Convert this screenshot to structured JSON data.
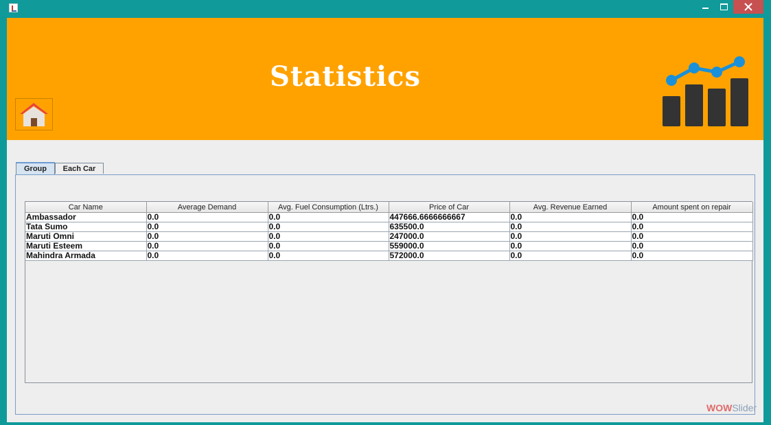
{
  "window": {
    "icon": "java-coffee-icon"
  },
  "header": {
    "title": "Statistics",
    "home_icon": "house-icon",
    "stats_icon": "bar-line-chart-icon"
  },
  "tabs": [
    {
      "label": "Group",
      "selected": true
    },
    {
      "label": "Each Car",
      "selected": false
    }
  ],
  "table": {
    "columns": [
      "Car Name",
      "Average Demand",
      "Avg. Fuel Consumption (Ltrs.)",
      "Price of Car",
      "Avg. Revenue Earned",
      "Amount spent on repair"
    ],
    "rows": [
      [
        "Ambassador",
        "0.0",
        "0.0",
        "447666.6666666667",
        "0.0",
        "0.0"
      ],
      [
        "Tata Sumo",
        "0.0",
        "0.0",
        "635500.0",
        "0.0",
        "0.0"
      ],
      [
        "Maruti Omni",
        "0.0",
        "0.0",
        "247000.0",
        "0.0",
        "0.0"
      ],
      [
        "Maruti Esteem",
        "0.0",
        "0.0",
        "559000.0",
        "0.0",
        "0.0"
      ],
      [
        "Mahindra Armada",
        "0.0",
        "0.0",
        "572000.0",
        "0.0",
        "0.0"
      ]
    ]
  },
  "watermark": {
    "part1": "WOW",
    "part2": "Slider"
  },
  "colors": {
    "header": "#ffa200",
    "window": "#0f9a9a",
    "close": "#c75050"
  }
}
